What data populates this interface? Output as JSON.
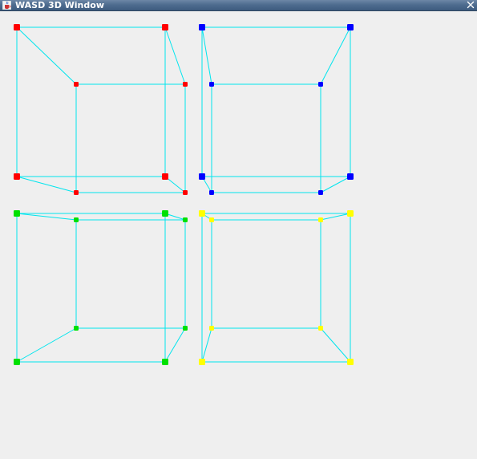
{
  "window": {
    "title": "WASD 3D Window",
    "icons": {
      "app": "java-cup-icon",
      "close": "close-icon"
    }
  },
  "scene": {
    "edge_color": "#00e5ee",
    "background_color": "#efefef",
    "cubes": [
      {
        "name": "red",
        "color": "#ff0000"
      },
      {
        "name": "blue",
        "color": "#0000ff"
      },
      {
        "name": "green",
        "color": "#00e000"
      },
      {
        "name": "yellow",
        "color": "#ffff00"
      }
    ]
  }
}
